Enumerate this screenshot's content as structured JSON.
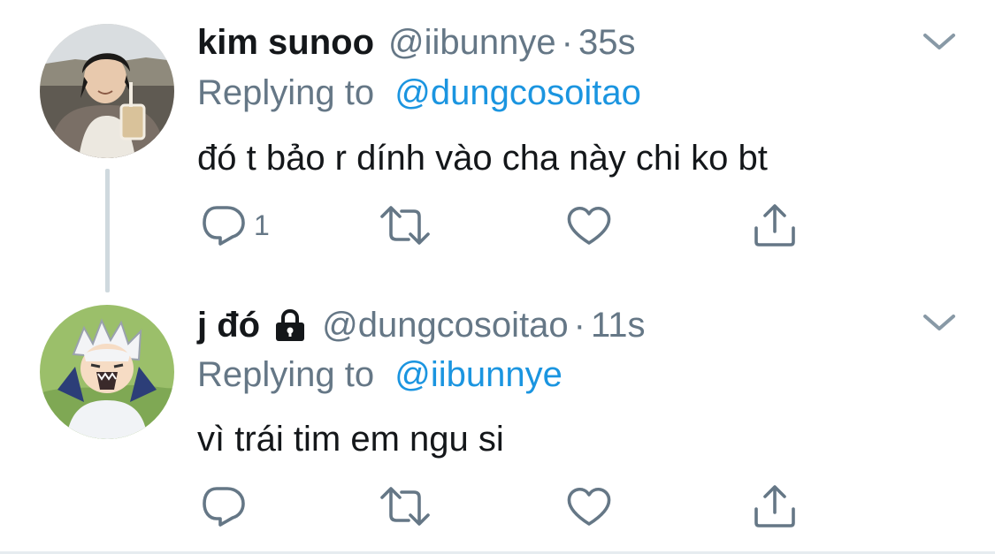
{
  "tweets": [
    {
      "display_name": "kim sunoo",
      "handle": "@iibunnye",
      "separator": "·",
      "time": "35s",
      "replying_label": "Replying to",
      "replying_to": "@dungcosoitao",
      "text": "đó t bảo r dính vào cha này chi ko bt",
      "reply_count": "1",
      "protected": false
    },
    {
      "display_name": "j đó",
      "handle": "@dungcosoitao",
      "separator": "·",
      "time": "11s",
      "replying_label": "Replying to",
      "replying_to": "@iibunnye",
      "text": "vì trái tim em ngu si",
      "reply_count": "",
      "protected": true
    }
  ],
  "icons": {
    "reply": "speech-bubble-icon",
    "retweet": "retweet-icon",
    "like": "heart-icon",
    "share": "share-icon",
    "more": "chevron-down-icon",
    "protected": "lock-icon"
  },
  "colors": {
    "text": "#14171a",
    "secondary": "#657786",
    "link": "#1b95e0",
    "icon": "#657786",
    "thread_line": "#cfd9de",
    "divider": "#e6ecf0"
  }
}
